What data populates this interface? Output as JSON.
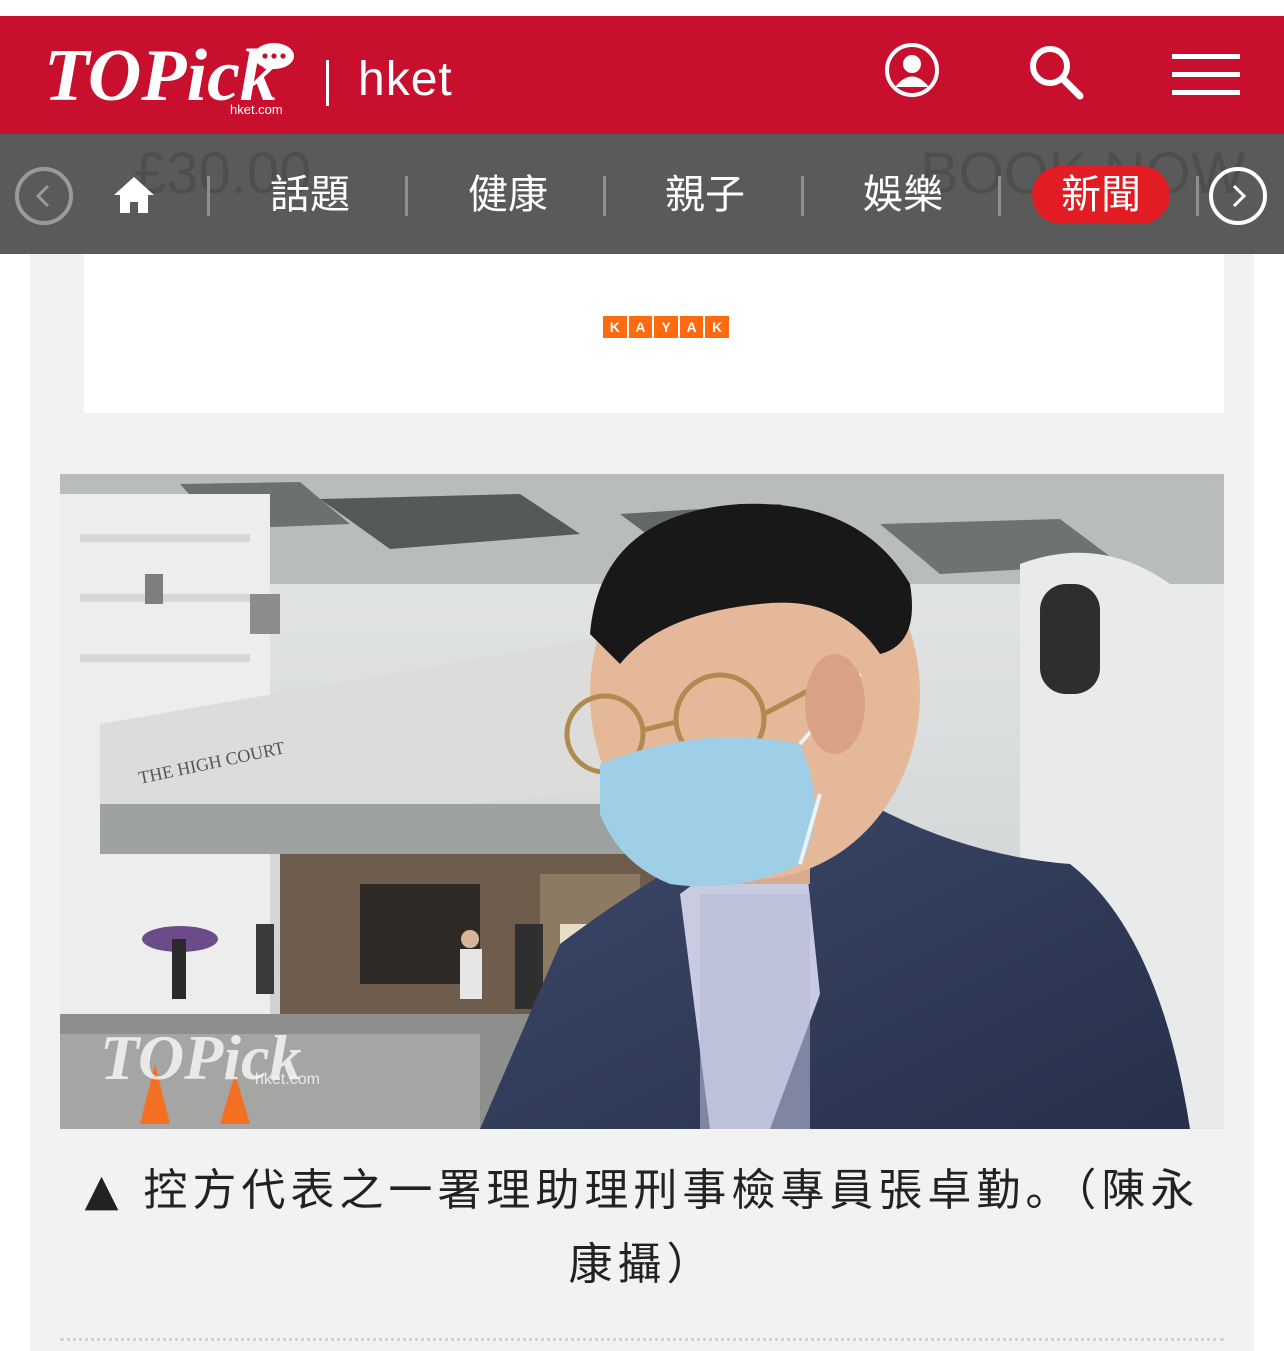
{
  "header": {
    "logo_text": "TOPick",
    "logo_subtext": "hket.com",
    "brand": "hket",
    "icons": [
      "user-icon",
      "search-icon",
      "hamburger-menu-icon"
    ],
    "background_color": "#c8102e"
  },
  "nav": {
    "items": [
      {
        "label": "話題",
        "active": false
      },
      {
        "label": "健康",
        "active": false
      },
      {
        "label": "親子",
        "active": false
      },
      {
        "label": "娛樂",
        "active": false
      },
      {
        "label": "新聞",
        "active": true
      }
    ],
    "icons": [
      "chevron-left-icon",
      "home-icon",
      "chevron-right-icon"
    ],
    "background_color": "#5a5a5a",
    "active_color": "#e21c23",
    "background_ad_text": {
      "price": "£30.00",
      "cta": "BOOK NOW"
    }
  },
  "ad": {
    "logo_letters": [
      "K",
      "A",
      "Y",
      "A",
      "K"
    ],
    "brand_color": "#ff690f"
  },
  "article": {
    "photo_watermark": {
      "logo": "TOPick",
      "domain": "hket.com"
    },
    "photo_building_sign": "THE HIGH COURT",
    "caption_arrow": "▲",
    "caption": "控方代表之一署理助理刑事檢專員張卓勤。（陳永康攝）"
  }
}
